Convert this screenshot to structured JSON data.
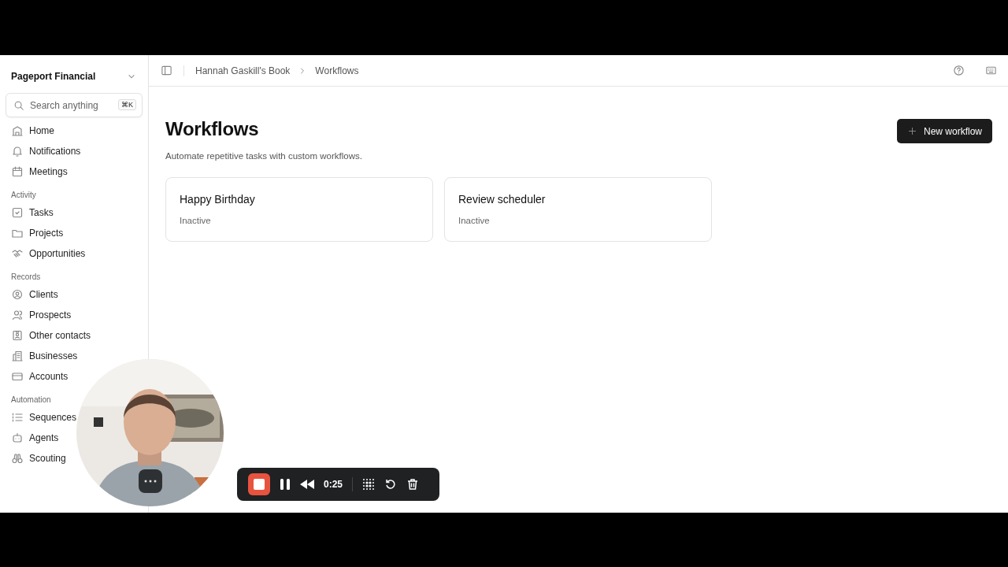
{
  "sidebar": {
    "org": "Pageport Financial",
    "search": {
      "placeholder": "Search anything",
      "shortcut": "⌘K"
    },
    "sections": [
      {
        "items": [
          {
            "label": "Home"
          },
          {
            "label": "Notifications"
          },
          {
            "label": "Meetings"
          }
        ]
      },
      {
        "label": "Activity",
        "items": [
          {
            "label": "Tasks"
          },
          {
            "label": "Projects"
          },
          {
            "label": "Opportunities"
          }
        ]
      },
      {
        "label": "Records",
        "items": [
          {
            "label": "Clients"
          },
          {
            "label": "Prospects"
          },
          {
            "label": "Other contacts"
          },
          {
            "label": "Businesses"
          },
          {
            "label": "Accounts"
          }
        ]
      },
      {
        "label": "Automation",
        "items": [
          {
            "label": "Sequences"
          },
          {
            "label": "Agents"
          },
          {
            "label": "Scouting"
          }
        ]
      }
    ]
  },
  "breadcrumb": [
    "Hannah Gaskill's Book",
    "Workflows"
  ],
  "page": {
    "title": "Workflows",
    "subtitle": "Automate repetitive tasks with custom workflows.",
    "new_button": "New workflow"
  },
  "workflows": [
    {
      "name": "Happy Birthday",
      "status": "Inactive"
    },
    {
      "name": "Review scheduler",
      "status": "Inactive"
    }
  ],
  "recorder": {
    "time": "0:25"
  },
  "webcam": {
    "kind": "picture"
  }
}
